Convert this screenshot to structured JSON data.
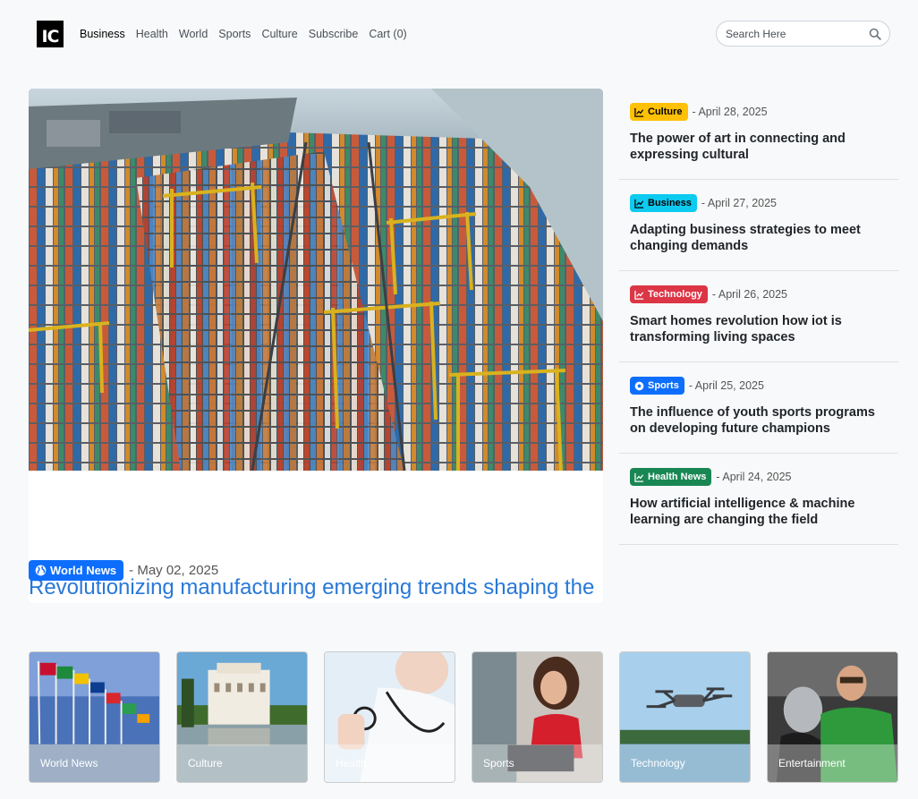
{
  "header": {
    "logo": "IC",
    "nav": [
      {
        "label": "Business",
        "active": true
      },
      {
        "label": "Health",
        "active": false
      },
      {
        "label": "World",
        "active": false
      },
      {
        "label": "Sports",
        "active": false
      },
      {
        "label": "Culture",
        "active": false
      },
      {
        "label": "Subscribe",
        "active": false
      },
      {
        "label": "Cart (0)",
        "active": false
      }
    ],
    "search": {
      "placeholder": "Search Here",
      "icon": "search-icon"
    }
  },
  "hero": {
    "title": "Revolutionizing manufacturing emerging trends shaping the industry",
    "category": "World News",
    "category_icon": "globe-icon",
    "category_color": "#0d6efd",
    "date": "- May 02, 2025"
  },
  "side_posts": [
    {
      "category": "Culture",
      "icon": "chart-line-icon",
      "bg": "#ffc107",
      "fg": "#000000",
      "date": "- April 28, 2025",
      "title": "The power of art in connecting and expressing cultural"
    },
    {
      "category": "Business",
      "icon": "chart-line-icon",
      "bg": "#0dcaf0",
      "fg": "#000000",
      "date": "- April 27, 2025",
      "title": "Adapting business strategies to meet changing demands"
    },
    {
      "category": "Technology",
      "icon": "chart-line-icon",
      "bg": "#dc3545",
      "fg": "#ffffff",
      "date": "- April 26, 2025",
      "title": "Smart homes revolution how iot is transforming living spaces"
    },
    {
      "category": "Sports",
      "icon": "soccer-ball-icon",
      "bg": "#0d6efd",
      "fg": "#ffffff",
      "date": "- April 25, 2025",
      "title": "The influence of youth sports programs on developing future champions"
    },
    {
      "category": "Health News",
      "icon": "chart-line-icon",
      "bg": "#198754",
      "fg": "#ffffff",
      "date": "- April 24, 2025",
      "title": "How artificial intelligence & machine learning are changing the field"
    }
  ],
  "categories": [
    {
      "label": "World News"
    },
    {
      "label": "Culture"
    },
    {
      "label": "Health"
    },
    {
      "label": "Sports"
    },
    {
      "label": "Technology"
    },
    {
      "label": "Entertainment"
    }
  ]
}
